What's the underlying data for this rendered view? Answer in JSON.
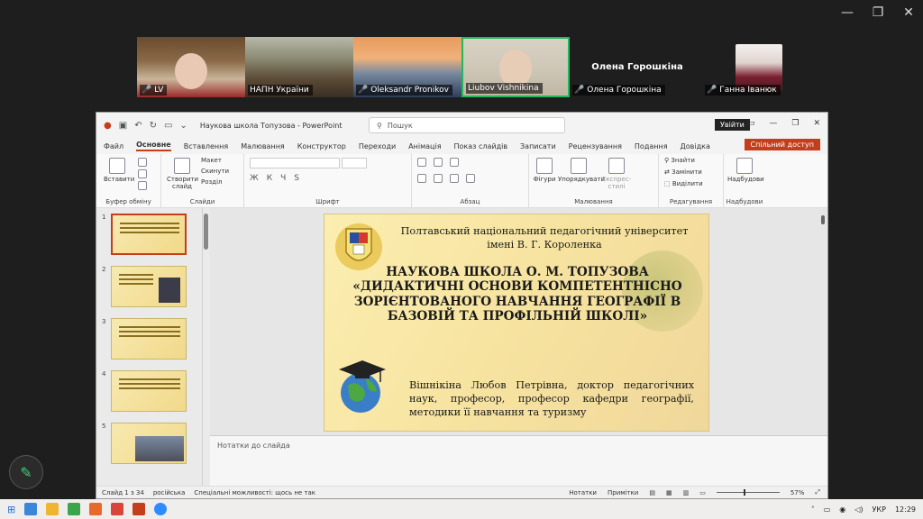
{
  "window": {
    "minimize": "—",
    "restore": "❐",
    "close": "✕"
  },
  "participants": [
    {
      "name": "LV",
      "muted": true
    },
    {
      "name": "НАПН України",
      "muted": false
    },
    {
      "name": "Oleksandr Pronikov",
      "muted": true
    },
    {
      "name": "Liubov Vishnikina",
      "muted": false
    },
    {
      "name": "Олена Горошкіна",
      "muted": true
    },
    {
      "name": "Ганна Іванюк",
      "muted": true
    }
  ],
  "name_card": "Олена Горошкіна",
  "powerpoint": {
    "title": "Наукова школа Топузова  -  PowerPoint",
    "search_placeholder": "Пошук",
    "signin": "Увійти",
    "share": "Спільний доступ",
    "tabs": [
      "Файл",
      "Основне",
      "Вставлення",
      "Малювання",
      "Конструктор",
      "Переходи",
      "Анімація",
      "Показ слайдів",
      "Записати",
      "Рецензування",
      "Подання",
      "Довідка"
    ],
    "ribbon": {
      "paste": "Вставити",
      "clipboard": "Буфер обміну",
      "new_slide": "Створити слайд",
      "layout": "Макет",
      "reset": "Скинути",
      "section": "Розділ",
      "slides": "Слайди",
      "font": "Шрифт",
      "paragraph": "Абзац",
      "shapes": "Фігури",
      "arrange": "Упорядкувати",
      "quick_styles": "Експрес-стилі",
      "drawing": "Малювання",
      "find": "Знайти",
      "replace": "Замінити",
      "select": "Виділити",
      "editing": "Редагування",
      "addins": "Надбудови",
      "addins_group": "Надбудови"
    },
    "thumbnail_numbers": [
      "1",
      "2",
      "3",
      "4",
      "5"
    ],
    "slide": {
      "university_line1": "Полтавський національний педагогічний університет",
      "university_line2": "імені В. Г. Короленка",
      "title_line1": "НАУКОВА ШКОЛА О. М. ТОПУЗОВА",
      "title_line2": "«ДИДАКТИЧНІ ОСНОВИ КОМПЕТЕНТНІСНО",
      "title_line3": "ЗОРІЄНТОВАНОГО НАВЧАННЯ ГЕОГРАФІЇ В",
      "title_line4": "БАЗОВІЙ ТА ПРОФІЛЬНІЙ ШКОЛІ»",
      "author": "Вішнікіна Любов Петрівна, доктор педагогічних наук, професор, професор кафедри географії, методики її навчання та туризму"
    },
    "notes_placeholder": "Нотатки до слайда",
    "status": {
      "slide_count": "Слайд 1 з 34",
      "language": "російська",
      "accessibility": "Спеціальні можливості: щось не так",
      "notes": "Нотатки",
      "comments": "Примітки",
      "zoom": "57%"
    }
  },
  "taskbar": {
    "language": "УКР",
    "time": "12:29"
  }
}
